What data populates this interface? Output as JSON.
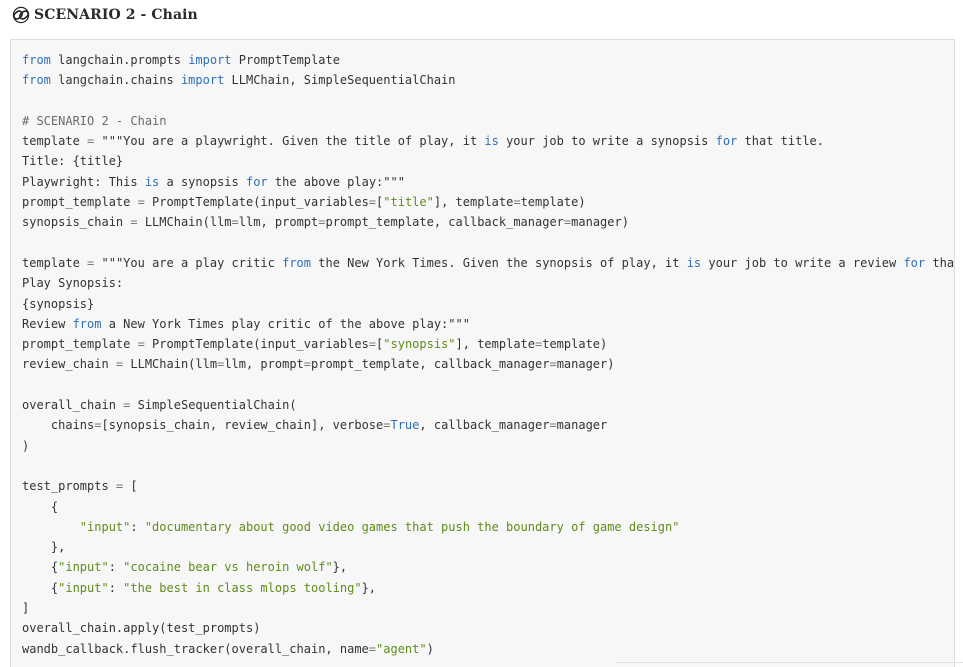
{
  "header": {
    "icon": "link-chain-icon",
    "title": "SCENARIO 2 - Chain"
  },
  "code": {
    "language": "python",
    "lines": [
      [
        {
          "t": "kw",
          "v": "from"
        },
        {
          "t": "tx",
          "v": " langchain.prompts "
        },
        {
          "t": "kw",
          "v": "import"
        },
        {
          "t": "tx",
          "v": " PromptTemplate"
        }
      ],
      [
        {
          "t": "kw",
          "v": "from"
        },
        {
          "t": "tx",
          "v": " langchain.chains "
        },
        {
          "t": "kw",
          "v": "import"
        },
        {
          "t": "tx",
          "v": " LLMChain, SimpleSequentialChain"
        }
      ],
      [],
      [
        {
          "t": "cm",
          "v": "# SCENARIO 2 - Chain"
        }
      ],
      [
        {
          "t": "tx",
          "v": "template "
        },
        {
          "t": "op",
          "v": "="
        },
        {
          "t": "tx",
          "v": " \"\"\"You are a playwright. Given the title of play, it "
        },
        {
          "t": "kw",
          "v": "is"
        },
        {
          "t": "tx",
          "v": " your job to write a synopsis "
        },
        {
          "t": "kw",
          "v": "for"
        },
        {
          "t": "tx",
          "v": " that title."
        }
      ],
      [
        {
          "t": "tx",
          "v": "Title: {title}"
        }
      ],
      [
        {
          "t": "tx",
          "v": "Playwright: This "
        },
        {
          "t": "kw",
          "v": "is"
        },
        {
          "t": "tx",
          "v": " a synopsis "
        },
        {
          "t": "kw",
          "v": "for"
        },
        {
          "t": "tx",
          "v": " the above play:\"\"\""
        }
      ],
      [
        {
          "t": "tx",
          "v": "prompt_template "
        },
        {
          "t": "op",
          "v": "="
        },
        {
          "t": "tx",
          "v": " PromptTemplate(input_variables"
        },
        {
          "t": "op",
          "v": "="
        },
        {
          "t": "tx",
          "v": "["
        },
        {
          "t": "str",
          "v": "\"title\""
        },
        {
          "t": "tx",
          "v": "], template"
        },
        {
          "t": "op",
          "v": "="
        },
        {
          "t": "tx",
          "v": "template)"
        }
      ],
      [
        {
          "t": "tx",
          "v": "synopsis_chain "
        },
        {
          "t": "op",
          "v": "="
        },
        {
          "t": "tx",
          "v": " LLMChain(llm"
        },
        {
          "t": "op",
          "v": "="
        },
        {
          "t": "tx",
          "v": "llm, prompt"
        },
        {
          "t": "op",
          "v": "="
        },
        {
          "t": "tx",
          "v": "prompt_template, callback_manager"
        },
        {
          "t": "op",
          "v": "="
        },
        {
          "t": "tx",
          "v": "manager)"
        }
      ],
      [],
      [
        {
          "t": "tx",
          "v": "template "
        },
        {
          "t": "op",
          "v": "="
        },
        {
          "t": "tx",
          "v": " \"\"\"You are a play critic "
        },
        {
          "t": "kw",
          "v": "from"
        },
        {
          "t": "tx",
          "v": " the New York Times. Given the synopsis of play, it "
        },
        {
          "t": "kw",
          "v": "is"
        },
        {
          "t": "tx",
          "v": " your job to write a review "
        },
        {
          "t": "kw",
          "v": "for"
        },
        {
          "t": "tx",
          "v": " that play."
        }
      ],
      [
        {
          "t": "tx",
          "v": "Play Synopsis:"
        }
      ],
      [
        {
          "t": "tx",
          "v": "{synopsis}"
        }
      ],
      [
        {
          "t": "tx",
          "v": "Review "
        },
        {
          "t": "kw",
          "v": "from"
        },
        {
          "t": "tx",
          "v": " a New York Times play critic of the above play:\"\"\""
        }
      ],
      [
        {
          "t": "tx",
          "v": "prompt_template "
        },
        {
          "t": "op",
          "v": "="
        },
        {
          "t": "tx",
          "v": " PromptTemplate(input_variables"
        },
        {
          "t": "op",
          "v": "="
        },
        {
          "t": "tx",
          "v": "["
        },
        {
          "t": "str",
          "v": "\"synopsis\""
        },
        {
          "t": "tx",
          "v": "], template"
        },
        {
          "t": "op",
          "v": "="
        },
        {
          "t": "tx",
          "v": "template)"
        }
      ],
      [
        {
          "t": "tx",
          "v": "review_chain "
        },
        {
          "t": "op",
          "v": "="
        },
        {
          "t": "tx",
          "v": " LLMChain(llm"
        },
        {
          "t": "op",
          "v": "="
        },
        {
          "t": "tx",
          "v": "llm, prompt"
        },
        {
          "t": "op",
          "v": "="
        },
        {
          "t": "tx",
          "v": "prompt_template, callback_manager"
        },
        {
          "t": "op",
          "v": "="
        },
        {
          "t": "tx",
          "v": "manager)"
        }
      ],
      [],
      [
        {
          "t": "tx",
          "v": "overall_chain "
        },
        {
          "t": "op",
          "v": "="
        },
        {
          "t": "tx",
          "v": " SimpleSequentialChain("
        }
      ],
      [
        {
          "t": "tx",
          "v": "    chains"
        },
        {
          "t": "op",
          "v": "="
        },
        {
          "t": "tx",
          "v": "[synopsis_chain, review_chain], verbose"
        },
        {
          "t": "op",
          "v": "="
        },
        {
          "t": "kw",
          "v": "True"
        },
        {
          "t": "tx",
          "v": ", callback_manager"
        },
        {
          "t": "op",
          "v": "="
        },
        {
          "t": "tx",
          "v": "manager"
        }
      ],
      [
        {
          "t": "tx",
          "v": ")"
        }
      ],
      [],
      [
        {
          "t": "tx",
          "v": "test_prompts "
        },
        {
          "t": "op",
          "v": "="
        },
        {
          "t": "tx",
          "v": " ["
        }
      ],
      [
        {
          "t": "tx",
          "v": "    {"
        }
      ],
      [
        {
          "t": "tx",
          "v": "        "
        },
        {
          "t": "str",
          "v": "\"input\""
        },
        {
          "t": "tx",
          "v": ": "
        },
        {
          "t": "str",
          "v": "\"documentary about good video games that push the boundary of game design\""
        }
      ],
      [
        {
          "t": "tx",
          "v": "    },"
        }
      ],
      [
        {
          "t": "tx",
          "v": "    {"
        },
        {
          "t": "str",
          "v": "\"input\""
        },
        {
          "t": "tx",
          "v": ": "
        },
        {
          "t": "str",
          "v": "\"cocaine bear vs heroin wolf\""
        },
        {
          "t": "tx",
          "v": "},"
        }
      ],
      [
        {
          "t": "tx",
          "v": "    {"
        },
        {
          "t": "str",
          "v": "\"input\""
        },
        {
          "t": "tx",
          "v": ": "
        },
        {
          "t": "str",
          "v": "\"the best in class mlops tooling\""
        },
        {
          "t": "tx",
          "v": "},"
        }
      ],
      [
        {
          "t": "tx",
          "v": "]"
        }
      ],
      [
        {
          "t": "tx",
          "v": "overall_chain.apply(test_prompts)"
        }
      ],
      [
        {
          "t": "tx",
          "v": "wandb_callback.flush_tracker(overall_chain, name"
        },
        {
          "t": "op",
          "v": "="
        },
        {
          "t": "str",
          "v": "\"agent\""
        },
        {
          "t": "tx",
          "v": ")"
        }
      ]
    ]
  },
  "colors": {
    "keyword": "#2f6fb6",
    "string": "#5f8c1b",
    "comment": "#6b6b6b",
    "text": "#333333",
    "code_background": "#f7f7f7",
    "code_border": "#dcdcdc"
  }
}
